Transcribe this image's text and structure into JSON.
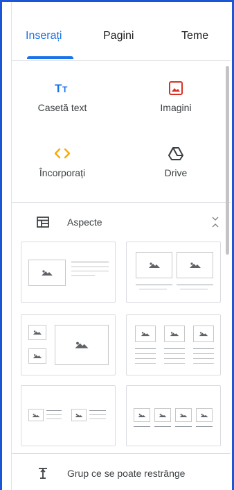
{
  "tabs": [
    {
      "label": "Inserați",
      "active": true
    },
    {
      "label": "Pagini",
      "active": false
    },
    {
      "label": "Teme",
      "active": false
    }
  ],
  "insert": {
    "text_box": {
      "label": "Casetă text",
      "icon": "text-box-icon",
      "color": "#1a73e8"
    },
    "images": {
      "label": "Imagini",
      "icon": "image-icon",
      "color": "#d93025"
    },
    "embed": {
      "label": "Încorporați",
      "icon": "embed-code-icon",
      "color": "#f9ab00"
    },
    "drive": {
      "label": "Drive",
      "icon": "drive-icon",
      "color": "#5f6368"
    }
  },
  "layouts": {
    "title": "Aspecte",
    "icon": "layout-icon",
    "collapse_icon": "collapse-chevron-icon"
  },
  "group": {
    "label": "Grup ce se poate restrânge",
    "icon": "collapsible-group-icon"
  },
  "colors": {
    "accent": "#1a73e8",
    "frame": "#1a56d6"
  }
}
